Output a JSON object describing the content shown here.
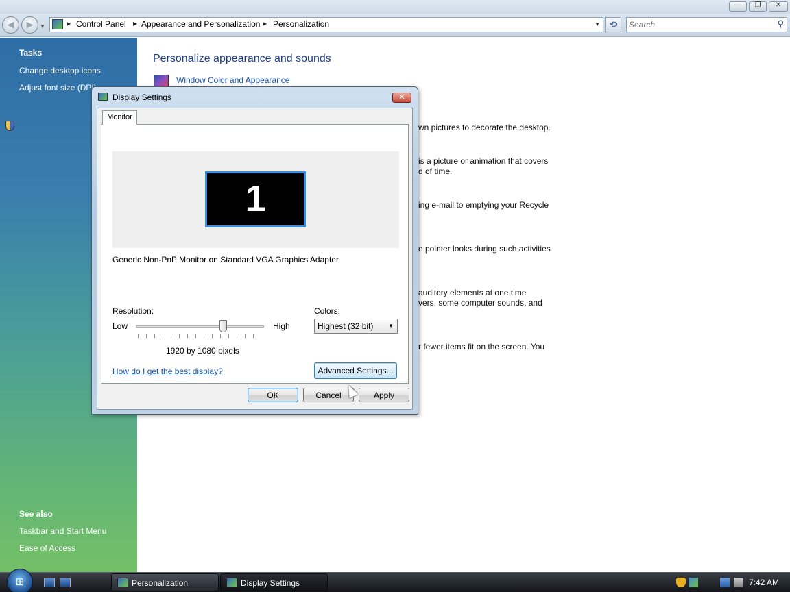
{
  "titlebar": {
    "minimize": "—",
    "maximize": "❐",
    "close": "✕"
  },
  "nav": {
    "back_glyph": "◀",
    "forward_glyph": "▶",
    "breadcrumbs": [
      "Control Panel",
      "Appearance and Personalization",
      "Personalization"
    ],
    "search_placeholder": "Search",
    "search_icon": "magnifier-icon",
    "refresh_glyph": "⟲"
  },
  "sidebar": {
    "tasks_heading": "Tasks",
    "tasks": [
      "Change desktop icons",
      "Adjust font size (DPI)"
    ],
    "see_also_heading": "See also",
    "see_also": [
      "Taskbar and Start Menu",
      "Ease of Access"
    ]
  },
  "main": {
    "title": "Personalize appearance and sounds",
    "first_link": "Window Color and Appearance",
    "desc_lines": [
      "wn pictures to decorate the desktop.",
      "is a picture or animation that covers",
      "d of time.",
      "ing e-mail to emptying your Recycle",
      "e pointer looks during such activities",
      "auditory elements at one time",
      "vers, some computer sounds, and",
      "r fewer items fit on the screen. You"
    ]
  },
  "dialog": {
    "title": "Display Settings",
    "close_glyph": "✕",
    "tab": "Monitor",
    "monitor_number": "1",
    "monitor_desc": "Generic Non-PnP Monitor on Standard VGA Graphics Adapter",
    "resolution_label": "Resolution:",
    "low_label": "Low",
    "high_label": "High",
    "resolution_value": "1920 by 1080 pixels",
    "slider_level": 0.68,
    "colors_label": "Colors:",
    "colors_value": "Highest (32 bit)",
    "help_link": "How do I get the best display?",
    "advanced_button": "Advanced Settings...",
    "ok_button": "OK",
    "cancel_button": "Cancel",
    "apply_button": "Apply"
  },
  "taskbar": {
    "start_glyph": "⊞",
    "buttons": [
      "Personalization",
      "Display Settings"
    ],
    "clock": "7:42 AM"
  },
  "colors": {
    "link": "#1a54ad",
    "title_blue": "#1e3f8a",
    "monitor_highlight": "#3a8ee0"
  }
}
